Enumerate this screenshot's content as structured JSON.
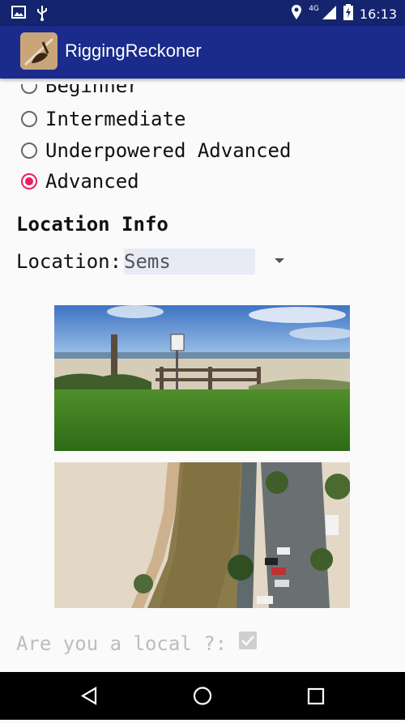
{
  "status_bar": {
    "time": "16:13",
    "network": "4G",
    "icons": [
      "image-icon",
      "usb-icon",
      "location-icon",
      "signal-icon",
      "battery-icon"
    ]
  },
  "app_bar": {
    "title": "RiggingReckoner",
    "icon": "app-logo-icon"
  },
  "skill_options": [
    {
      "label": "Beginner",
      "checked": false
    },
    {
      "label": "Intermediate",
      "checked": false
    },
    {
      "label": "Underpowered Advanced",
      "checked": false
    },
    {
      "label": "Advanced",
      "checked": true
    }
  ],
  "location_info": {
    "title": "Location Info",
    "label": "Location:",
    "selected": "Sems"
  },
  "local_question": {
    "label": "Are you a local ?:",
    "checked": true
  },
  "colors": {
    "status_bar": "#14246e",
    "app_bar": "#1a2b8c",
    "accent": "#e91e63",
    "select_bg": "#e8eaf6"
  },
  "nav_bar": {
    "buttons": [
      "back-icon",
      "home-icon",
      "recents-icon"
    ]
  }
}
